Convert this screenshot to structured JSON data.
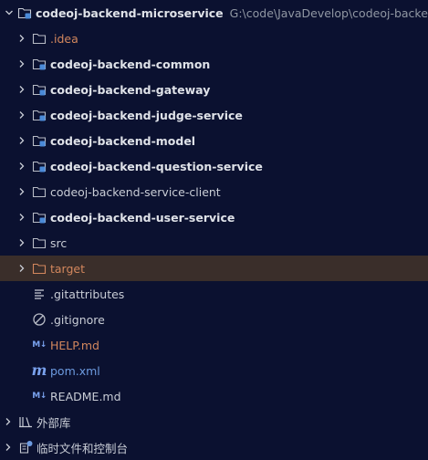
{
  "root": {
    "name": "codeoj-backend-microservice",
    "path": "G:\\code\\JavaDevelop\\codeoj-backend-m"
  },
  "items": [
    {
      "label": ".idea",
      "style": "orange"
    },
    {
      "label": "codeoj-backend-common",
      "style": "bold"
    },
    {
      "label": "codeoj-backend-gateway",
      "style": "bold"
    },
    {
      "label": "codeoj-backend-judge-service",
      "style": "bold"
    },
    {
      "label": "codeoj-backend-model",
      "style": "bold"
    },
    {
      "label": "codeoj-backend-question-service",
      "style": "bold"
    },
    {
      "label": "codeoj-backend-service-client",
      "style": "plain"
    },
    {
      "label": "codeoj-backend-user-service",
      "style": "bold"
    },
    {
      "label": "src",
      "style": "plain"
    },
    {
      "label": "target",
      "style": "orange"
    },
    {
      "label": ".gitattributes",
      "style": "plain"
    },
    {
      "label": ".gitignore",
      "style": "plain"
    },
    {
      "label": "HELP.md",
      "style": "orange"
    },
    {
      "label": "pom.xml",
      "style": "blue"
    },
    {
      "label": "README.md",
      "style": "plain"
    },
    {
      "label": "外部库",
      "style": "plain"
    },
    {
      "label": "临时文件和控制台",
      "style": "plain"
    }
  ],
  "colors": {
    "background": "#0b1130",
    "selected_row": "#3a2e2a",
    "folder_orange": "#d3875d",
    "module_blue": "#4b8ad8",
    "text": "#c9cdd6"
  },
  "icons": [
    "chevron-down-icon",
    "chevron-right-icon",
    "module-folder-icon",
    "folder-icon",
    "text-file-icon",
    "ignore-file-icon",
    "markdown-icon",
    "maven-icon",
    "library-icon",
    "scratches-icon"
  ]
}
